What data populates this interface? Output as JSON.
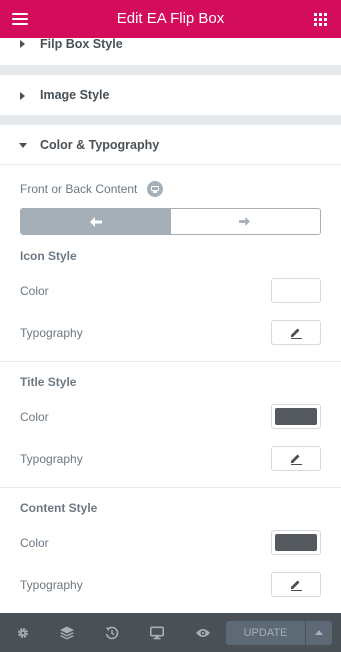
{
  "header": {
    "title": "Edit EA Flip Box",
    "menu_icon": "hamburger-icon",
    "apps_icon": "grid-icon"
  },
  "sections": {
    "flipbox_style": "Filp Box Style",
    "image_style": "Image Style",
    "color_typography": "Color & Typography"
  },
  "controls": {
    "front_back_label": "Front or Back Content",
    "front_icon": "arrow-left-icon",
    "back_icon": "arrow-right-icon",
    "icon_style": {
      "heading": "Icon Style",
      "color_label": "Color",
      "typography_label": "Typography",
      "color_value": "#ffffff"
    },
    "title_style": {
      "heading": "Title Style",
      "color_label": "Color",
      "typography_label": "Typography",
      "color_value": "#54595f"
    },
    "content_style": {
      "heading": "Content Style",
      "color_label": "Color",
      "typography_label": "Typography",
      "color_value": "#54595f"
    }
  },
  "footer": {
    "icons": [
      "settings-icon",
      "layers-icon",
      "history-icon",
      "responsive-icon",
      "preview-icon"
    ],
    "update_label": "UPDATE"
  },
  "colors": {
    "brand": "#d30c5c",
    "panel_dark": "#495157"
  }
}
